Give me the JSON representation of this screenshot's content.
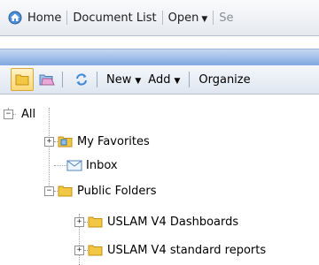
{
  "topbar": {
    "home_label": "Home",
    "document_list_label": "Document List",
    "open_label": "Open",
    "truncated_label": "Se"
  },
  "toolbar": {
    "new_label": "New",
    "add_label": "Add",
    "organize_label": "Organize"
  },
  "tree": {
    "root_label": "All",
    "items": [
      {
        "label": "My Favorites"
      },
      {
        "label": "Inbox"
      },
      {
        "label": "Public Folders"
      },
      {
        "label": "USLAM V4 Dashboards"
      },
      {
        "label": "USLAM V4 standard reports"
      }
    ]
  },
  "colors": {
    "band_top": "#c6d8f2",
    "band_bottom": "#7fa7e0",
    "folder": "#f2c744",
    "active_button": "#ffd873"
  },
  "icons": [
    "home-icon",
    "folder-icon",
    "favorites-icon",
    "refresh-icon",
    "inbox-icon"
  ]
}
